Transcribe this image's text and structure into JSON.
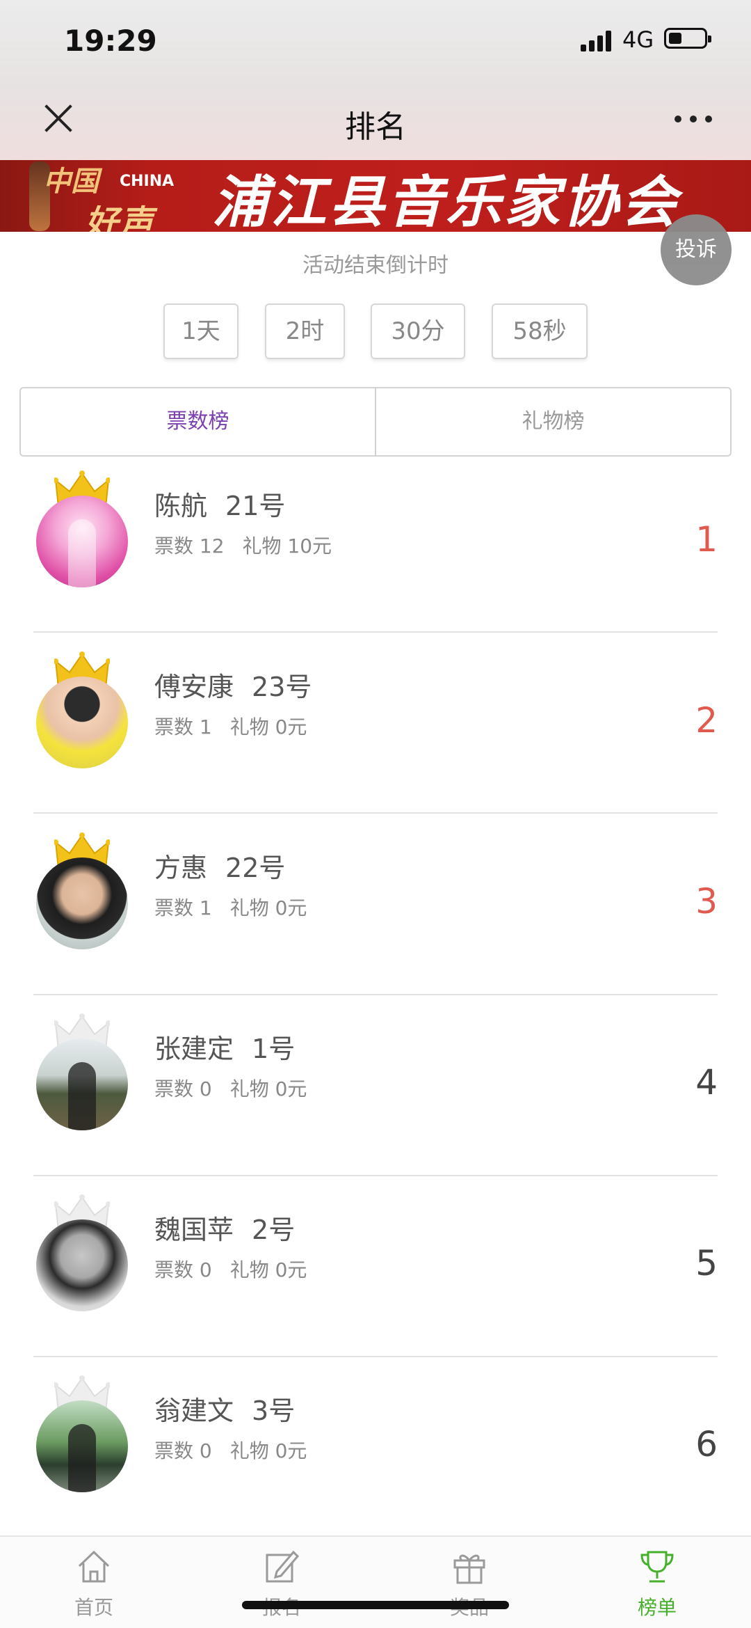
{
  "status_bar": {
    "time": "19:29",
    "network": "4G"
  },
  "nav": {
    "title": "排名"
  },
  "banner": {
    "logo_line1": "中国",
    "logo_tag": "CHINA",
    "logo_line2": "好声音",
    "title": "浦江县音乐家协会"
  },
  "complaint_label": "投诉",
  "countdown": {
    "label": "活动结束倒计时",
    "parts": [
      "1天",
      "2时",
      "30分",
      "58秒"
    ]
  },
  "tabs": [
    {
      "label": "票数榜",
      "active": true
    },
    {
      "label": "礼物榜",
      "active": false
    }
  ],
  "entries": [
    {
      "name": "陈航",
      "number": "21号",
      "votes_label": "票数 12",
      "gift_label": "礼物 10元",
      "rank": "1",
      "crown": "gold"
    },
    {
      "name": "傅安康",
      "number": "23号",
      "votes_label": "票数 1",
      "gift_label": "礼物 0元",
      "rank": "2",
      "crown": "gold"
    },
    {
      "name": "方惠",
      "number": "22号",
      "votes_label": "票数 1",
      "gift_label": "礼物 0元",
      "rank": "3",
      "crown": "gold"
    },
    {
      "name": "张建定",
      "number": "1号",
      "votes_label": "票数 0",
      "gift_label": "礼物 0元",
      "rank": "4",
      "crown": "silver"
    },
    {
      "name": "魏国苹",
      "number": "2号",
      "votes_label": "票数 0",
      "gift_label": "礼物 0元",
      "rank": "5",
      "crown": "silver"
    },
    {
      "name": "翁建文",
      "number": "3号",
      "votes_label": "票数 0",
      "gift_label": "礼物 0元",
      "rank": "6",
      "crown": "silver"
    }
  ],
  "bottom_nav": [
    {
      "label": "首页",
      "icon": "home-icon",
      "active": false
    },
    {
      "label": "报名",
      "icon": "edit-icon",
      "active": false
    },
    {
      "label": "奖品",
      "icon": "gift-icon",
      "active": false
    },
    {
      "label": "榜单",
      "icon": "trophy-icon",
      "active": true
    }
  ],
  "colors": {
    "accent_active_tab": "#7b3fb0",
    "rank_top": "#e05a4f",
    "bottom_active": "#46b02a",
    "banner_red": "#bf1f1c"
  }
}
